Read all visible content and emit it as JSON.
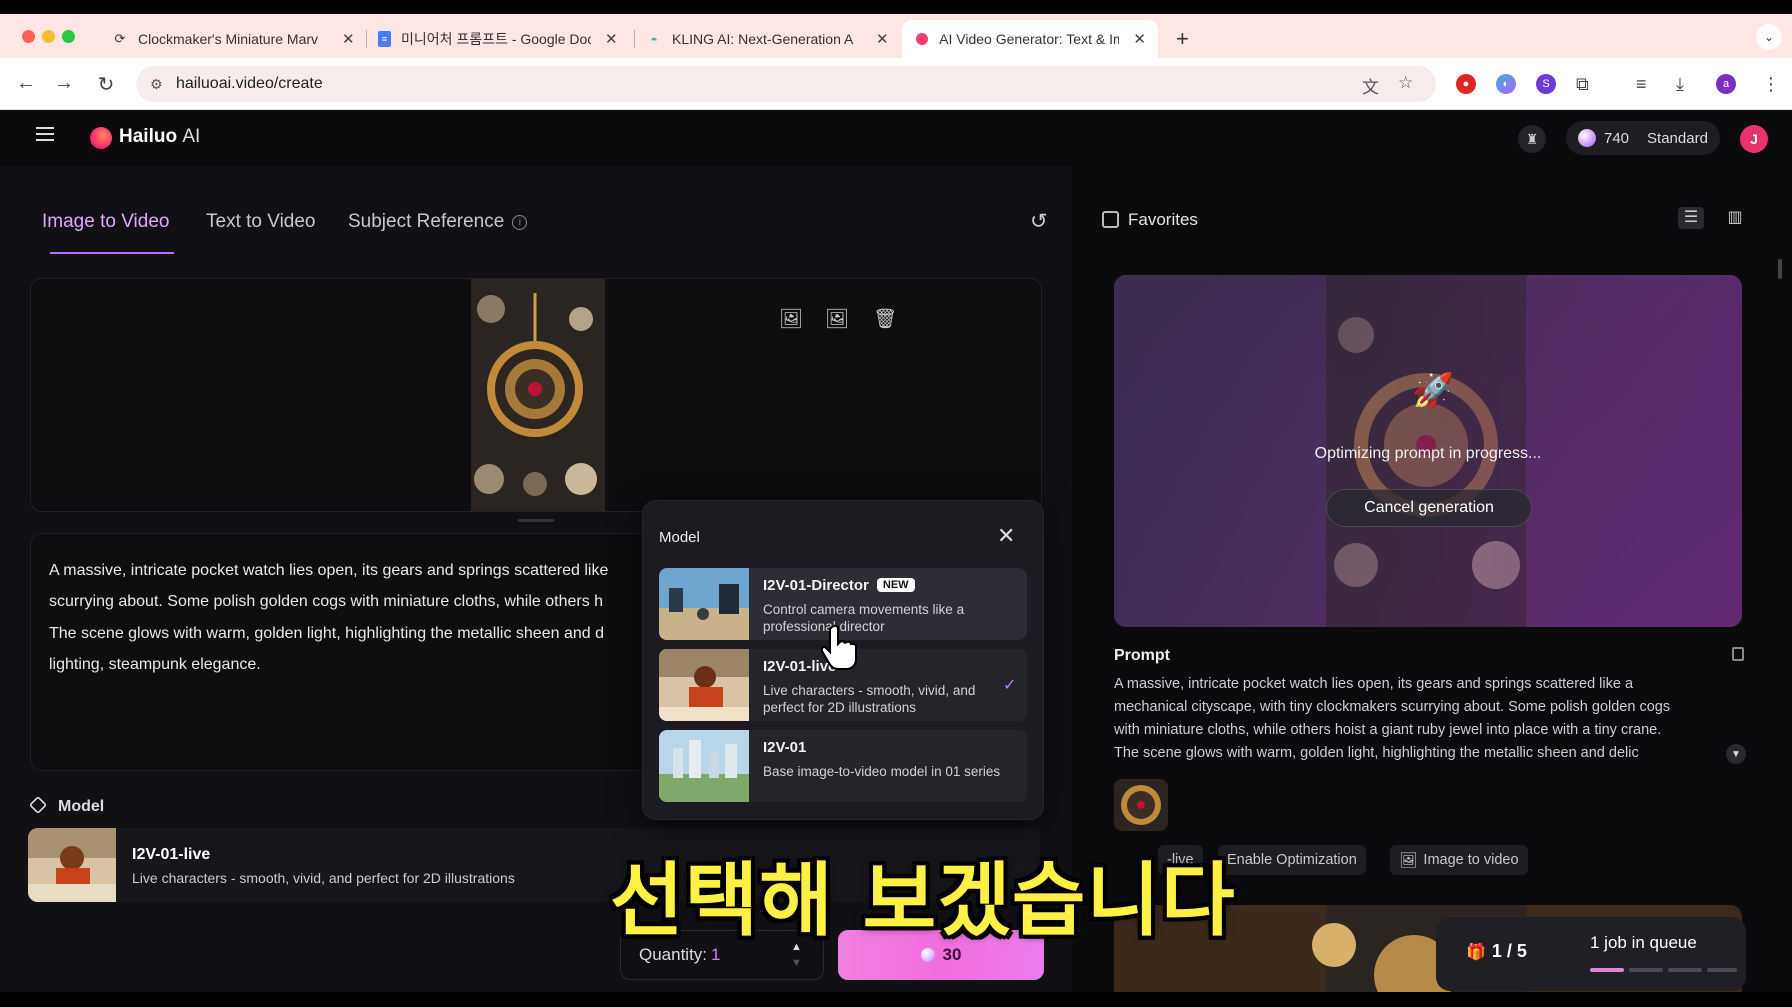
{
  "browser": {
    "tabs": [
      {
        "title": "Clockmaker's Miniature Marv",
        "icon": "refresh-spinner-icon"
      },
      {
        "title": "미니어처 프롬프트 - Google Doc",
        "icon": "google-docs-icon"
      },
      {
        "title": "KLING AI: Next-Generation A",
        "icon": "kling-icon"
      },
      {
        "title": "AI Video Generator: Text & Im",
        "icon": "hailuo-icon"
      }
    ],
    "url": "hailuoai.video/create",
    "profile_initial": "a"
  },
  "app": {
    "brand": "Hailuo",
    "brand_suffix": "AI",
    "credits": "740",
    "plan": "Standard",
    "user_initial": "J"
  },
  "left": {
    "tabs": [
      "Image to Video",
      "Text to Video",
      "Subject Reference"
    ],
    "active_tab": "Image to Video",
    "prompt_lines": [
      "A massive, intricate pocket watch lies open, its gears and springs scattered like",
      "scurrying about. Some polish golden cogs with miniature cloths, while others h",
      "The scene glows with warm, golden light, highlighting the metallic sheen and d",
      "lighting, steampunk elegance."
    ],
    "model_section_label": "Model",
    "selected_model": {
      "name": "I2V-01-live",
      "description": "Live characters - smooth, vivid, and perfect for 2D illustrations"
    },
    "quantity_label": "Quantity:",
    "quantity_value": "1",
    "generate_cost": "30"
  },
  "model_popup": {
    "title": "Model",
    "options": [
      {
        "name": "I2V-01-Director",
        "badge": "NEW",
        "description": "Control camera movements like a professional director",
        "selected": false
      },
      {
        "name": "I2V-01-live",
        "badge": "",
        "description": "Live characters - smooth, vivid, and perfect for 2D illustrations",
        "selected": true
      },
      {
        "name": "I2V-01",
        "badge": "",
        "description": "Base image-to-video model in 01 series",
        "selected": false
      }
    ]
  },
  "right": {
    "favorites_label": "Favorites",
    "status_text": "Optimizing prompt in progress...",
    "cancel_label": "Cancel generation",
    "prompt_heading": "Prompt",
    "prompt_lines": [
      "A massive, intricate pocket watch lies open, its gears and springs scattered like a",
      "mechanical cityscape, with tiny clockmakers scurrying about. Some polish golden cogs",
      "with miniature cloths, while others hoist a giant ruby jewel into place with a tiny crane.",
      "The scene glows with warm, golden light, highlighting the metallic sheen and delic"
    ],
    "chips": [
      "-live",
      "Enable Optimization",
      "Image to video"
    ],
    "queue_count": "1 / 5",
    "queue_status": "1 job in queue"
  },
  "caption": "선택해 보겠습니다",
  "colors": {
    "accent": "#b86dff",
    "generate_button": "#f26ddd",
    "caption": "#fff045"
  }
}
